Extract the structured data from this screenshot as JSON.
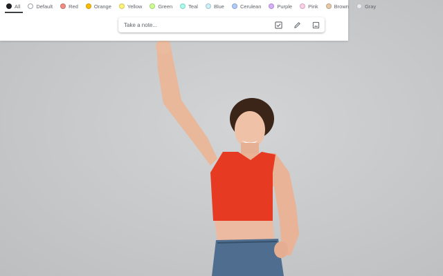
{
  "filters": [
    {
      "label": "All",
      "color": "#202124",
      "active": true
    },
    {
      "label": "Default",
      "color": "#ffffff"
    },
    {
      "label": "Red",
      "color": "#f28b82"
    },
    {
      "label": "Orange",
      "color": "#fbbc04"
    },
    {
      "label": "Yellow",
      "color": "#fff475"
    },
    {
      "label": "Green",
      "color": "#ccff90"
    },
    {
      "label": "Teal",
      "color": "#a7ffeb"
    },
    {
      "label": "Blue",
      "color": "#cbf0f8"
    },
    {
      "label": "Cerulean",
      "color": "#aecbfa"
    },
    {
      "label": "Purple",
      "color": "#d7aefb"
    },
    {
      "label": "Pink",
      "color": "#fdcfe8"
    },
    {
      "label": "Brown",
      "color": "#e6c9a8"
    },
    {
      "label": "Gray",
      "color": "#e8eaed"
    }
  ],
  "note_bar": {
    "placeholder": "Take a note...",
    "tools": [
      "checkbox-icon",
      "pencil-icon",
      "image-icon"
    ]
  }
}
